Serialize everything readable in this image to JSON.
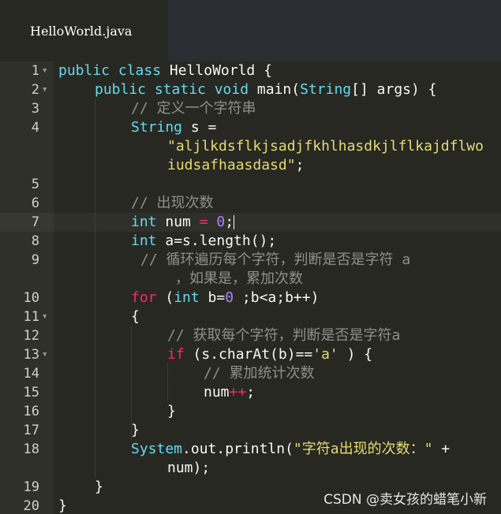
{
  "tab": {
    "title": "HelloWorld.java"
  },
  "gutter": {
    "line_numbers": [
      "1",
      "2",
      "3",
      "4",
      "5",
      "6",
      "7",
      "8",
      "9",
      "10",
      "11",
      "12",
      "13",
      "14",
      "15",
      "16",
      "17",
      "18",
      "19",
      "20"
    ]
  },
  "code": {
    "l1_a": "public class",
    "l1_b": " HelloWorld {",
    "l2_a": "public static void",
    "l2_b": " main(",
    "l2_c": "String",
    "l2_d": "[] args) {",
    "l3": "// 定义一个字符串",
    "l4_a": "String",
    "l4_b": " s =",
    "l4_c": "\"aljlkdsflkjsadjfkhlhasdkjlflkajdflwo",
    "l4_d": "iudsafhaasdasd\"",
    "l4_e": ";",
    "l6": "// 出现次数",
    "l7_a": "int",
    "l7_b": " num ",
    "l7_c": "=",
    "l7_d": " ",
    "l7_e": "0",
    "l7_f": ";",
    "l8_a": "int",
    "l8_b": " a=s.length();",
    "l9_a": "// 循环遍历每个字符，判断是否是字符 a",
    "l9_b": "，如果是，累加次数",
    "l10_a": "for",
    "l10_b": " (",
    "l10_c": "int",
    "l10_d": " b=",
    "l10_e": "0",
    "l10_f": " ;b<a;b++)",
    "l11": "{",
    "l12": "// 获取每个字符，判断是否是字符a",
    "l13_a": "if",
    "l13_b": " (s.charAt(b)==",
    "l13_c": "'a'",
    "l13_d": " ) {",
    "l14": "// 累加统计次数",
    "l15_a": "num",
    "l15_b": "++",
    "l15_c": ";",
    "l16": "}",
    "l17": "}",
    "l18_a": "System",
    "l18_b": ".out.println(",
    "l18_c": "\"字符a出现的次数：\"",
    "l18_d": " +",
    "l18_e": "num);",
    "l19": "}",
    "l20": "}"
  },
  "watermark": "CSDN @卖女孩的蜡笔小新",
  "colors": {
    "background": "#272822",
    "keyword": "#66d9ef",
    "storage": "#f92672",
    "string": "#e6db74",
    "number": "#ae81ff",
    "comment": "#8f908a"
  }
}
